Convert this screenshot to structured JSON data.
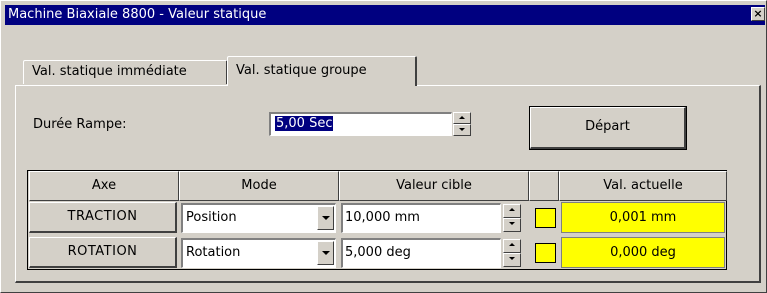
{
  "window": {
    "title": "Machine Biaxiale 8800 - Valeur statique",
    "close_label": "×"
  },
  "tabs": [
    {
      "label": "Val. statique immédiate",
      "active": false
    },
    {
      "label": "Val. statique groupe",
      "active": true
    }
  ],
  "ramp": {
    "label": "Durée Rampe:",
    "value": "5,00 Sec"
  },
  "start_button": {
    "label": "Départ"
  },
  "grid": {
    "headers": [
      "Axe",
      "Mode",
      "Valeur cible",
      "",
      "Val. actuelle"
    ],
    "rows": [
      {
        "axe": "TRACTION",
        "mode": "Position",
        "cible": "10,000 mm",
        "indicator_color": "#ffff00",
        "actuelle": "0,001 mm"
      },
      {
        "axe": "ROTATION",
        "mode": "Rotation",
        "cible": "5,000 deg",
        "indicator_color": "#ffff00",
        "actuelle": "0,000 deg"
      }
    ]
  },
  "colors": {
    "titlebar": "#000080",
    "face": "#d4d0c8",
    "highlight": "#ffff00"
  }
}
